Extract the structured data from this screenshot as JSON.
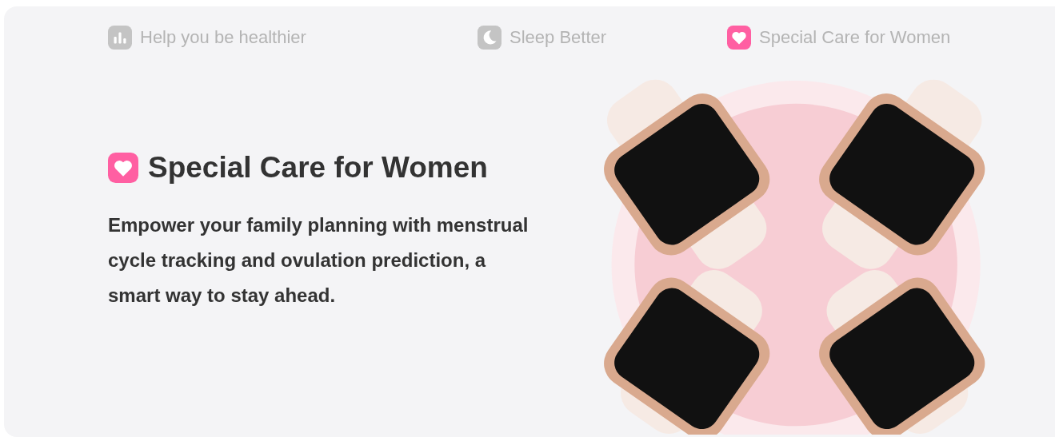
{
  "tabs": [
    {
      "kind": "chart",
      "label": "Help you be healthier",
      "selected": false
    },
    {
      "kind": "moon",
      "label": "Sleep Better",
      "selected": false
    },
    {
      "kind": "heart",
      "label": "Special Care for Women",
      "selected": true
    }
  ],
  "feature": {
    "title": "Special Care for Women",
    "description": "Empower your family planning with menstrual cycle tracking and ovulation prediction, a smart way to stay ahead."
  }
}
